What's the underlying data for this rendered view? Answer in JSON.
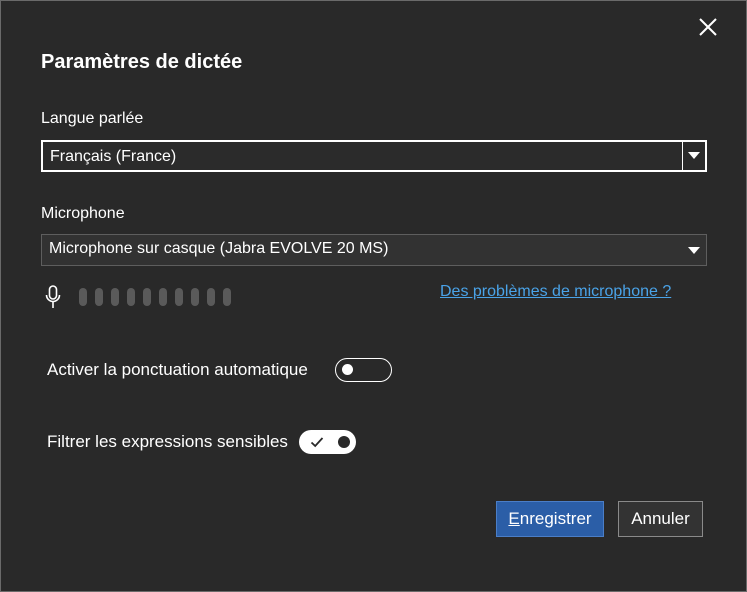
{
  "dialog": {
    "title": "Paramètres de dictée",
    "close_icon": "close-icon"
  },
  "language": {
    "label": "Langue parlée",
    "selected": "Français (France)",
    "icon": "chevron-down-icon"
  },
  "microphone": {
    "label": "Microphone",
    "selected": "Microphone sur casque (Jabra EVOLVE 20 MS)",
    "icon": "chevron-down-icon",
    "mic_icon": "microphone-icon",
    "level_bars": 10,
    "level_active": 0,
    "help_link": "Des problèmes de microphone ?"
  },
  "options": {
    "auto_punctuation": {
      "label": "Activer la ponctuation automatique",
      "enabled": false
    },
    "filter_sensitive": {
      "label": "Filtrer les expressions sensibles",
      "enabled": true,
      "icon": "checkmark-icon"
    }
  },
  "buttons": {
    "save_mnemonic": "E",
    "save_rest": "nregistrer",
    "cancel": "Annuler"
  },
  "colors": {
    "background": "#292929",
    "accent": "#2b5ea7",
    "link": "#4aa3e8"
  }
}
